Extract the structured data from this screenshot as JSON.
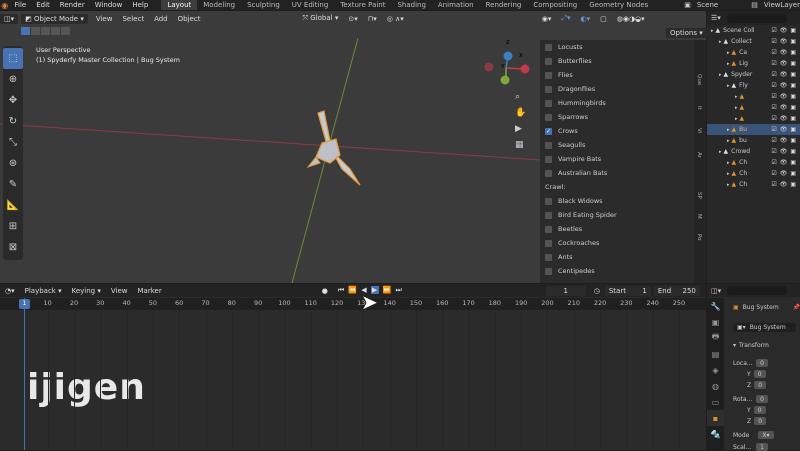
{
  "menubar": {
    "menus": [
      "File",
      "Edit",
      "Render",
      "Window",
      "Help"
    ],
    "workspaces": [
      "Layout",
      "Modeling",
      "Sculpting",
      "UV Editing",
      "Texture Paint",
      "Shading",
      "Animation",
      "Rendering",
      "Compositing",
      "Geometry Nodes"
    ],
    "active_workspace": "Layout",
    "scene": "Scene",
    "view_layer": "ViewLayer"
  },
  "viewport": {
    "mode": "Object Mode",
    "menus": [
      "View",
      "Select",
      "Add",
      "Object"
    ],
    "transform_orientation": "Global",
    "options_label": "Options",
    "perspective_label": "User Perspective",
    "active_object_label": "(1) Spyderfy Master Collection | Bug System",
    "gizmo_axes": [
      "X",
      "Y",
      "Z"
    ]
  },
  "list_panel": {
    "fly_items": [
      {
        "label": "Locusts",
        "checked": false
      },
      {
        "label": "Butterflies",
        "checked": false
      },
      {
        "label": "Flies",
        "checked": false
      },
      {
        "label": "Dragonflies",
        "checked": false
      },
      {
        "label": "Hummingbirds",
        "checked": false
      },
      {
        "label": "Sparrows",
        "checked": false
      },
      {
        "label": "Crows",
        "checked": true
      },
      {
        "label": "Seagulls",
        "checked": false
      },
      {
        "label": "Vampire Bats",
        "checked": false
      },
      {
        "label": "Australian Bats",
        "checked": false
      }
    ],
    "crawl_header": "Crawl:",
    "crawl_items": [
      {
        "label": "Black Widows",
        "checked": false
      },
      {
        "label": "Bird Eating Spider",
        "checked": false
      },
      {
        "label": "Beetles",
        "checked": false
      },
      {
        "label": "Cockroaches",
        "checked": false
      },
      {
        "label": "Ants",
        "checked": false
      },
      {
        "label": "Centipedes",
        "checked": false
      }
    ],
    "side_tabs": [
      "Que",
      "It",
      "Vi",
      "Ar",
      "SP",
      "M",
      "Po"
    ]
  },
  "outliner": {
    "rows": [
      {
        "label": "Scene Coll",
        "indent": 0,
        "selected": false
      },
      {
        "label": "Collect",
        "indent": 1,
        "selected": false
      },
      {
        "label": "Ca",
        "indent": 2,
        "selected": false
      },
      {
        "label": "Lig",
        "indent": 2,
        "selected": false
      },
      {
        "label": "Spyder",
        "indent": 1,
        "selected": false
      },
      {
        "label": "Fly",
        "indent": 2,
        "selected": false
      },
      {
        "label": "",
        "indent": 3,
        "selected": false
      },
      {
        "label": "",
        "indent": 3,
        "selected": false
      },
      {
        "label": "",
        "indent": 3,
        "selected": false
      },
      {
        "label": "Bu",
        "indent": 2,
        "selected": true
      },
      {
        "label": "bu",
        "indent": 2,
        "selected": false
      },
      {
        "label": "Crowd",
        "indent": 1,
        "selected": false
      },
      {
        "label": "Ch",
        "indent": 2,
        "selected": false
      },
      {
        "label": "Ch",
        "indent": 2,
        "selected": false
      },
      {
        "label": "Ch",
        "indent": 2,
        "selected": false
      }
    ]
  },
  "timeline": {
    "menus": [
      "Playback",
      "Keying",
      "View",
      "Marker"
    ],
    "current_frame": "1",
    "start_label": "Start",
    "start_value": "1",
    "end_label": "End",
    "end_value": "250",
    "frame_ticks": [
      "1",
      "10",
      "20",
      "30",
      "40",
      "50",
      "60",
      "70",
      "80",
      "90",
      "100",
      "110",
      "120",
      "130",
      "140",
      "150",
      "160",
      "170",
      "180",
      "190",
      "200",
      "210",
      "220",
      "230",
      "240",
      "250"
    ]
  },
  "properties": {
    "object_name": "Bug System",
    "data_name": "Bug System",
    "transform_header": "Transform",
    "location_label": "Loca...",
    "rotation_label": "Rota...",
    "scale_label": "Scal...",
    "axis_y": "Y",
    "axis_z": "Z",
    "loc_values": [
      "0",
      "0",
      "0"
    ],
    "rot_values": [
      "0",
      "0",
      "0"
    ],
    "scale_value": "1",
    "mode_label": "Mode",
    "mode_value": "X"
  },
  "watermark": "ijigen",
  "colors": {
    "accent": "#4772b3",
    "selection_orange": "#e0902f",
    "axis_x": "#c33a4a",
    "axis_y": "#7ea83a"
  }
}
